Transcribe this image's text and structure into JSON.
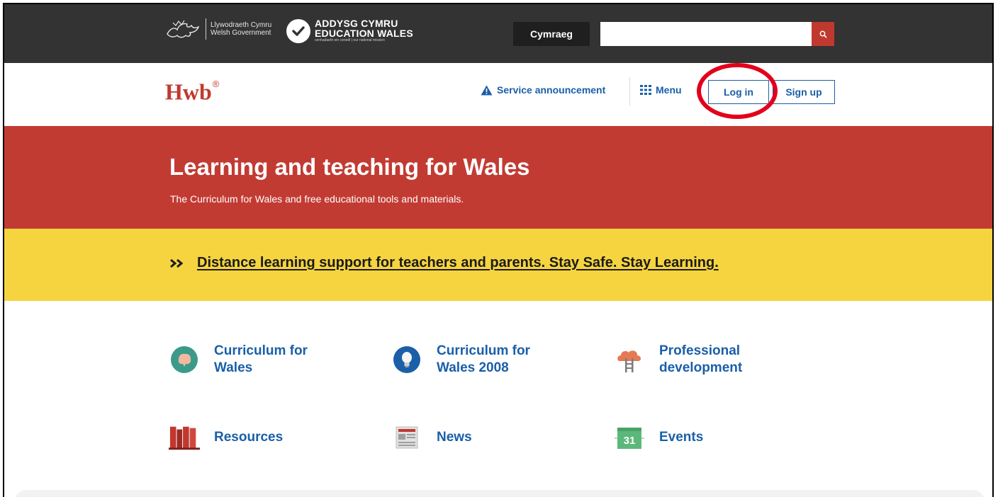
{
  "topbar": {
    "gov_logo_line1": "Llywodraeth Cymru",
    "gov_logo_line2": "Welsh Government",
    "edu_logo_line1": "ADDYSG CYMRU",
    "edu_logo_line2": "EDUCATION WALES",
    "edu_logo_tagline": "cenhadaeth ein cenedl | our national mission",
    "language_button": "Cymraeg",
    "search_placeholder": "",
    "search_icon": "search-icon"
  },
  "header": {
    "brand": "Hwb",
    "brand_mark": "®",
    "service_announcement": "Service announcement",
    "menu": "Menu",
    "login": "Log in",
    "signup": "Sign up"
  },
  "hero": {
    "title": "Learning and teaching for Wales",
    "subtitle": "The Curriculum for Wales and free educational tools and materials."
  },
  "banner": {
    "link": "Distance learning support for teachers and parents. Stay Safe. Stay Learning."
  },
  "tiles": [
    {
      "line1": "Curriculum for",
      "line2": "Wales",
      "icon": "brain-icon"
    },
    {
      "line1": "Curriculum for",
      "line2": "Wales 2008",
      "icon": "lightbulb-icon"
    },
    {
      "line1": "Professional",
      "line2": "development",
      "icon": "cloud-ladder-icon"
    },
    {
      "line1": "Resources",
      "line2": "",
      "icon": "books-icon"
    },
    {
      "line1": "News",
      "line2": "",
      "icon": "newspaper-icon"
    },
    {
      "line1": "Events",
      "line2": "",
      "icon": "calendar-icon",
      "calendar_day": "31"
    }
  ],
  "colors": {
    "topbar": "#333333",
    "brand_red": "#c0392f",
    "hero_red": "#c23b33",
    "banner_yellow": "#f5d43f",
    "link_blue": "#1a5fa8",
    "highlight": "#e3001b"
  }
}
